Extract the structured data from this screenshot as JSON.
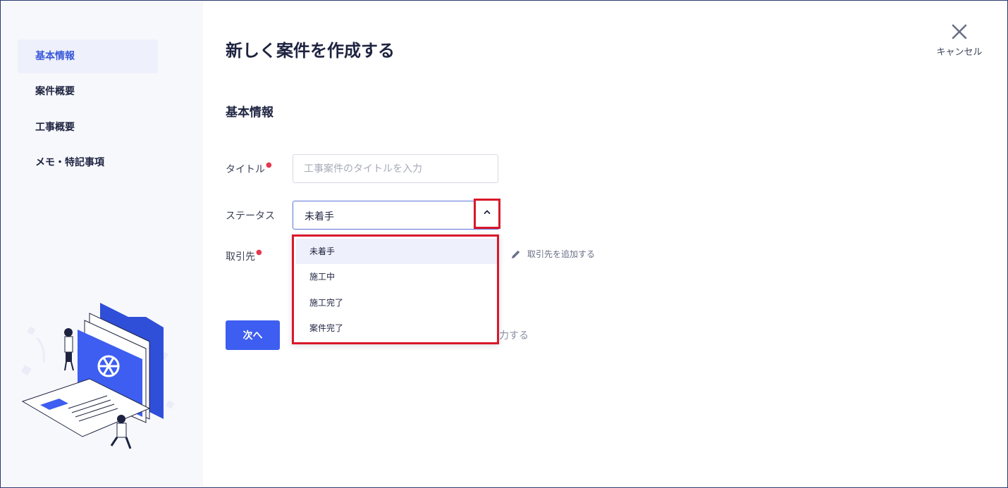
{
  "sidebar": {
    "items": [
      {
        "label": "基本情報",
        "active": true
      },
      {
        "label": "案件概要",
        "active": false
      },
      {
        "label": "工事概要",
        "active": false
      },
      {
        "label": "メモ・特記事項",
        "active": false
      }
    ]
  },
  "header": {
    "title": "新しく案件を作成する",
    "cancel_label": "キャンセル"
  },
  "form": {
    "section_title": "基本情報",
    "title_field": {
      "label": "タイトル",
      "placeholder": "工事案件のタイトルを入力",
      "value": "",
      "required": true
    },
    "status_field": {
      "label": "ステータス",
      "value": "未着手",
      "options": [
        "未着手",
        "施工中",
        "施工完了",
        "案件完了"
      ]
    },
    "client_field": {
      "label": "取引先",
      "required": true,
      "add_link": "取引先を追加する"
    },
    "next_button": "次へ",
    "later_link_visible": "力する"
  },
  "colors": {
    "accent": "#3d5ef0",
    "highlight_border": "#d9182a",
    "required": "#e53950",
    "sidebar_bg": "#f7f8fc"
  }
}
